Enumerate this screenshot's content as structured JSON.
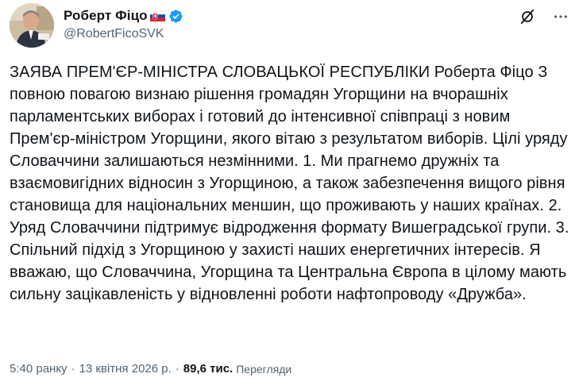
{
  "author": {
    "display_name": "Роберт Фіцо",
    "handle": "@RobertFicoSVK",
    "avatar": "avatar",
    "flag_icon": "slovakia-flag-icon",
    "verified_icon": "verified-badge-icon"
  },
  "header_actions": {
    "grok_icon": "grok-icon",
    "more_icon": "more-icon"
  },
  "tweet": {
    "text": "ЗАЯВА ПРЕМ'ЄР-МІНІСТРА СЛОВАЦЬКОЇ РЕСПУБЛІКИ Роберта Фіцо З повною повагою визнаю рішення громадян Угорщини на вчорашніх парламентських виборах і готовий до інтенсивної співпраці з новим Прем'єр-міністром Угорщини, якого вітаю з результатом виборів. Цілі уряду Словаччини залишаються незмінними. 1. Ми прагнемо дружніх та взаємовигідних відносин з Угорщиною, а також забезпечення вищого рівня становища для національних меншин, що проживають у наших країнах. 2. Уряд Словаччини підтримує відродження формату Вишеградської групи. 3. Спільний підхід з Угорщиною у захисті наших енергетичних інтересів. Я вважаю, що Словаччина, Угорщина та Центральна Європа в цілому мають сильну зацікавленість у відновленні роботи нафтопроводу «Дружба»."
  },
  "meta": {
    "time": "5:40 ранку",
    "separator": "·",
    "date": "13 квітня 2026 р.",
    "views_count": "89,6 тис.",
    "views_label": "Перегляди"
  },
  "colors": {
    "text": "#0f1419",
    "secondary": "#536471",
    "verified": "#1d9bf0"
  }
}
